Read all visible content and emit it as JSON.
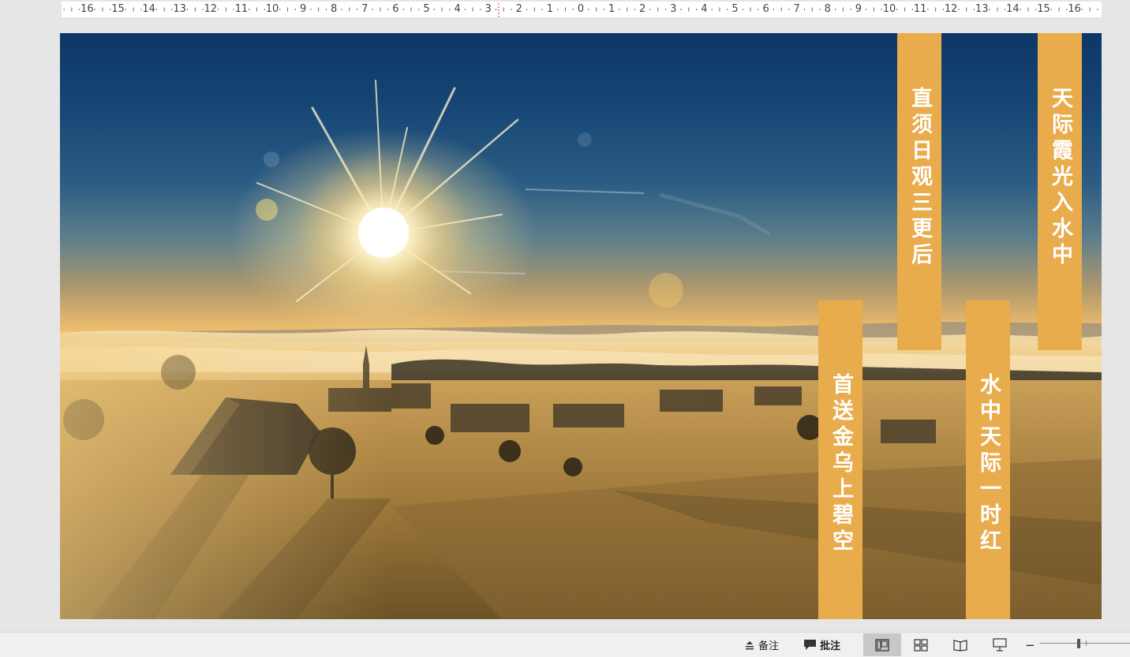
{
  "ruler": {
    "labels": [
      "16",
      "15",
      "14",
      "13",
      "12",
      "11",
      "10",
      "9",
      "8",
      "7",
      "6",
      "5",
      "4",
      "3",
      "2",
      "1",
      "0",
      "1",
      "2",
      "3",
      "4",
      "5",
      "6",
      "7",
      "8",
      "9",
      "10",
      "11",
      "12",
      "13",
      "14",
      "15",
      "16"
    ]
  },
  "slide": {
    "banners": [
      {
        "text": "直须日观三更后"
      },
      {
        "text": "天际霞光入水中"
      },
      {
        "text": "首送金乌上碧空"
      },
      {
        "text": "水中天际一时红"
      }
    ],
    "colors": {
      "banner": "#e9ac4d",
      "banner_text": "#ffffff"
    }
  },
  "statusbar": {
    "notes_label": "备注",
    "comments_label": "批注",
    "zoom_minus": "−",
    "active_view": "normal-view"
  }
}
